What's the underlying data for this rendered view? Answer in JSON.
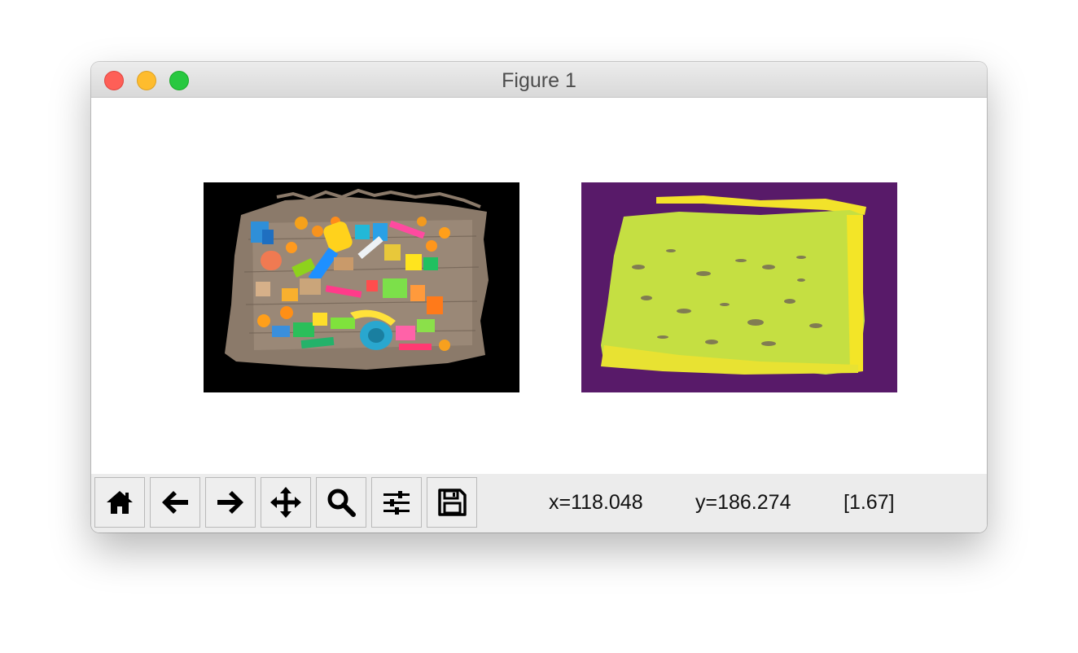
{
  "window": {
    "title": "Figure 1"
  },
  "figure": {
    "axes": [
      {
        "name": "rgb-image",
        "background": "#000000"
      },
      {
        "name": "depth-image",
        "colormap": "viridis",
        "background": "#581a69",
        "fill": "#c5df42"
      }
    ]
  },
  "toolbar": {
    "buttons": [
      {
        "name": "home",
        "icon": "home-icon"
      },
      {
        "name": "back",
        "icon": "arrow-left-icon"
      },
      {
        "name": "forward",
        "icon": "arrow-right-icon"
      },
      {
        "name": "pan",
        "icon": "move-arrows-icon"
      },
      {
        "name": "zoom",
        "icon": "magnifier-icon"
      },
      {
        "name": "configure-subplots",
        "icon": "sliders-icon"
      },
      {
        "name": "save",
        "icon": "floppy-disk-icon"
      }
    ],
    "x_readout": "x=118.048",
    "y_readout": "y=186.274",
    "value_readout": "[1.67]"
  }
}
